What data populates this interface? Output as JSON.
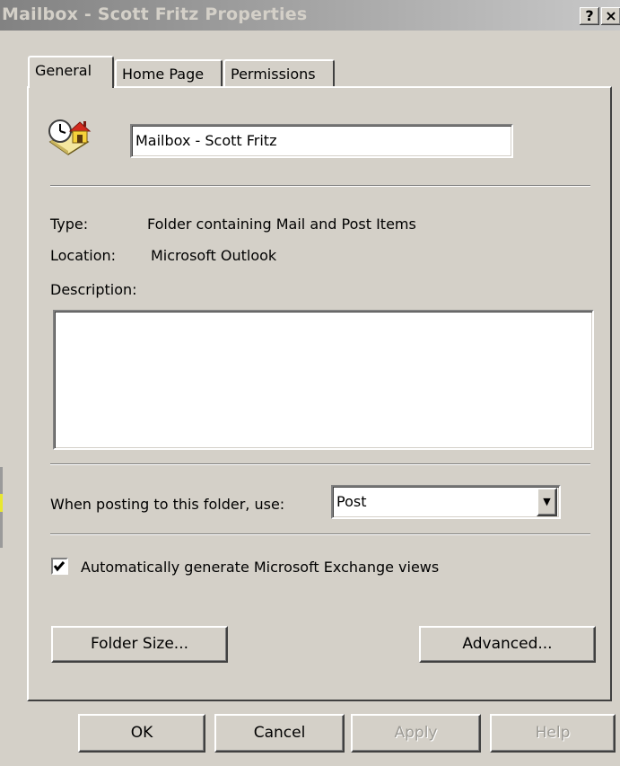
{
  "window": {
    "title": "Mailbox - Scott Fritz Properties",
    "help_button": "?",
    "close_button": "×"
  },
  "tabs": [
    "General",
    "Home Page",
    "Permissions"
  ],
  "general": {
    "folder_name": "Mailbox - Scott Fritz",
    "type_label": "Type:",
    "type_value": "Folder containing Mail and Post Items",
    "location_label": "Location:",
    "location_value": "Microsoft Outlook",
    "description_label": "Description:",
    "description_value": "",
    "posting_label": "When posting to this folder, use:",
    "posting_value": "Post",
    "auto_views_label": "Automatically generate Microsoft Exchange views",
    "auto_views_checked": true,
    "folder_size_button": "Folder Size...",
    "advanced_button": "Advanced..."
  },
  "footer": {
    "ok": "OK",
    "cancel": "Cancel",
    "apply": "Apply",
    "help": "Help"
  }
}
